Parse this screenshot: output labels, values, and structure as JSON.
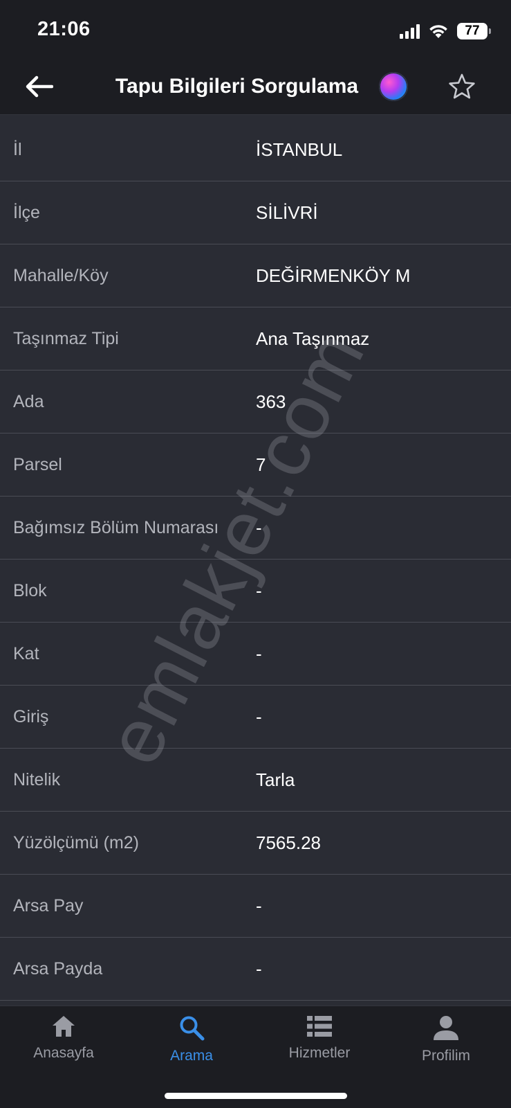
{
  "status_bar": {
    "time": "21:06",
    "battery": "77"
  },
  "nav": {
    "title": "Tapu Bilgileri Sorgulama",
    "back_icon": "arrow-left-icon",
    "siri_icon": "siri-icon",
    "favorite_icon": "star-outline-icon"
  },
  "rows": [
    {
      "label": "İl",
      "value": "İSTANBUL"
    },
    {
      "label": "İlçe",
      "value": "SİLİVRİ"
    },
    {
      "label": "Mahalle/Köy",
      "value": "DEĞİRMENKÖY M"
    },
    {
      "label": "Taşınmaz Tipi",
      "value": "Ana Taşınmaz"
    },
    {
      "label": "Ada",
      "value": "363"
    },
    {
      "label": "Parsel",
      "value": "7"
    },
    {
      "label": "Bağımsız Bölüm Numarası",
      "value": "-"
    },
    {
      "label": "Blok",
      "value": "-"
    },
    {
      "label": "Kat",
      "value": "-"
    },
    {
      "label": "Giriş",
      "value": "-"
    },
    {
      "label": "Nitelik",
      "value": "Tarla"
    },
    {
      "label": "Yüzölçümü (m2)",
      "value": "7565.28"
    },
    {
      "label": "Arsa Pay",
      "value": "-"
    },
    {
      "label": "Arsa Payda",
      "value": "-"
    }
  ],
  "watermark": "emlakjet.com",
  "tabs": [
    {
      "label": "Anasayfa",
      "icon": "home-icon",
      "active": false
    },
    {
      "label": "Arama",
      "icon": "search-icon",
      "active": true
    },
    {
      "label": "Hizmetler",
      "icon": "list-icon",
      "active": false
    },
    {
      "label": "Profilim",
      "icon": "person-icon",
      "active": false
    }
  ],
  "colors": {
    "background": "#2a2c34",
    "bar_background": "#1c1d22",
    "accent": "#3a8fe8",
    "label": "#b3b5bc",
    "value": "#ffffff"
  }
}
